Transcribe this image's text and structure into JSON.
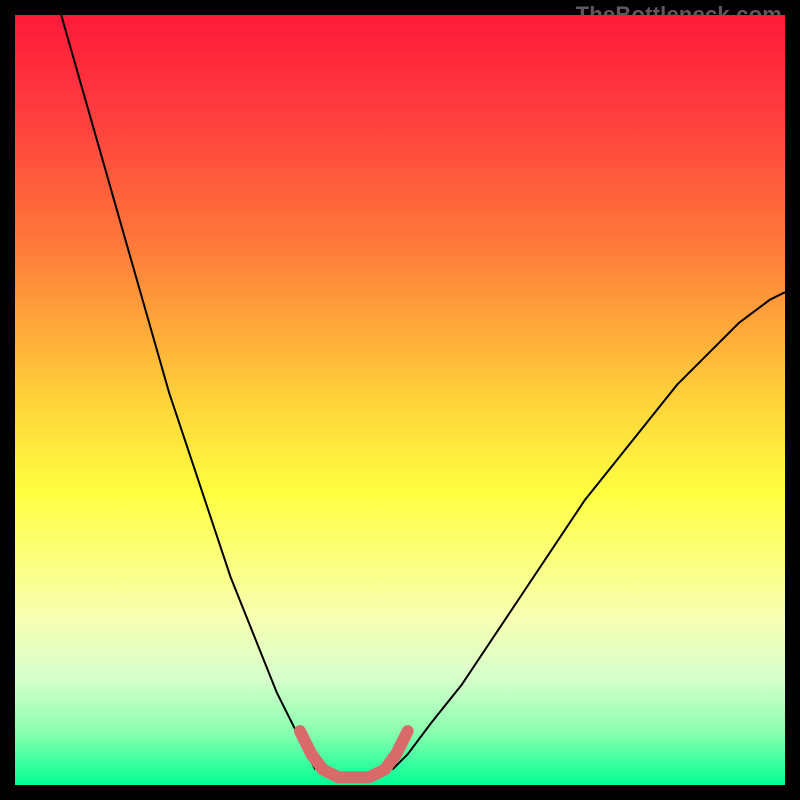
{
  "watermark": "TheBottleneck.com",
  "chart_data": {
    "type": "line",
    "title": "",
    "xlabel": "",
    "ylabel": "",
    "xlim": [
      0,
      100
    ],
    "ylim": [
      0,
      100
    ],
    "background_gradient": {
      "stops": [
        {
          "offset": 0.0,
          "color": "#ff1a3a"
        },
        {
          "offset": 0.12,
          "color": "#ff3a3f"
        },
        {
          "offset": 0.3,
          "color": "#ff7a3a"
        },
        {
          "offset": 0.5,
          "color": "#ffd23a"
        },
        {
          "offset": 0.62,
          "color": "#ffff40"
        },
        {
          "offset": 0.78,
          "color": "#f8ffb0"
        },
        {
          "offset": 0.86,
          "color": "#d8ffcc"
        },
        {
          "offset": 0.93,
          "color": "#8cffb0"
        },
        {
          "offset": 0.97,
          "color": "#3effa0"
        },
        {
          "offset": 1.0,
          "color": "#00ff95"
        }
      ]
    },
    "series": [
      {
        "name": "curve-left",
        "stroke": "#000000",
        "stroke_width": 2,
        "x": [
          6,
          8,
          10,
          12,
          14,
          16,
          18,
          20,
          22,
          24,
          26,
          28,
          30,
          32,
          34,
          36,
          38,
          39
        ],
        "y": [
          100,
          93,
          86,
          79,
          72,
          65,
          58,
          51,
          45,
          39,
          33,
          27,
          22,
          17,
          12,
          8,
          4,
          2
        ]
      },
      {
        "name": "curve-right",
        "stroke": "#000000",
        "stroke_width": 2,
        "x": [
          49,
          51,
          54,
          58,
          62,
          66,
          70,
          74,
          78,
          82,
          86,
          90,
          94,
          98,
          100
        ],
        "y": [
          2,
          4,
          8,
          13,
          19,
          25,
          31,
          37,
          42,
          47,
          52,
          56,
          60,
          63,
          64
        ]
      },
      {
        "name": "bottom-marker",
        "stroke": "#d86a6a",
        "stroke_width": 12,
        "stroke_linecap": "round",
        "stroke_linejoin": "round",
        "x": [
          37,
          38.5,
          40,
          42,
          44,
          46,
          48,
          49.5,
          51
        ],
        "y": [
          7,
          4,
          2,
          1,
          1,
          1,
          2,
          4,
          7
        ]
      }
    ]
  }
}
